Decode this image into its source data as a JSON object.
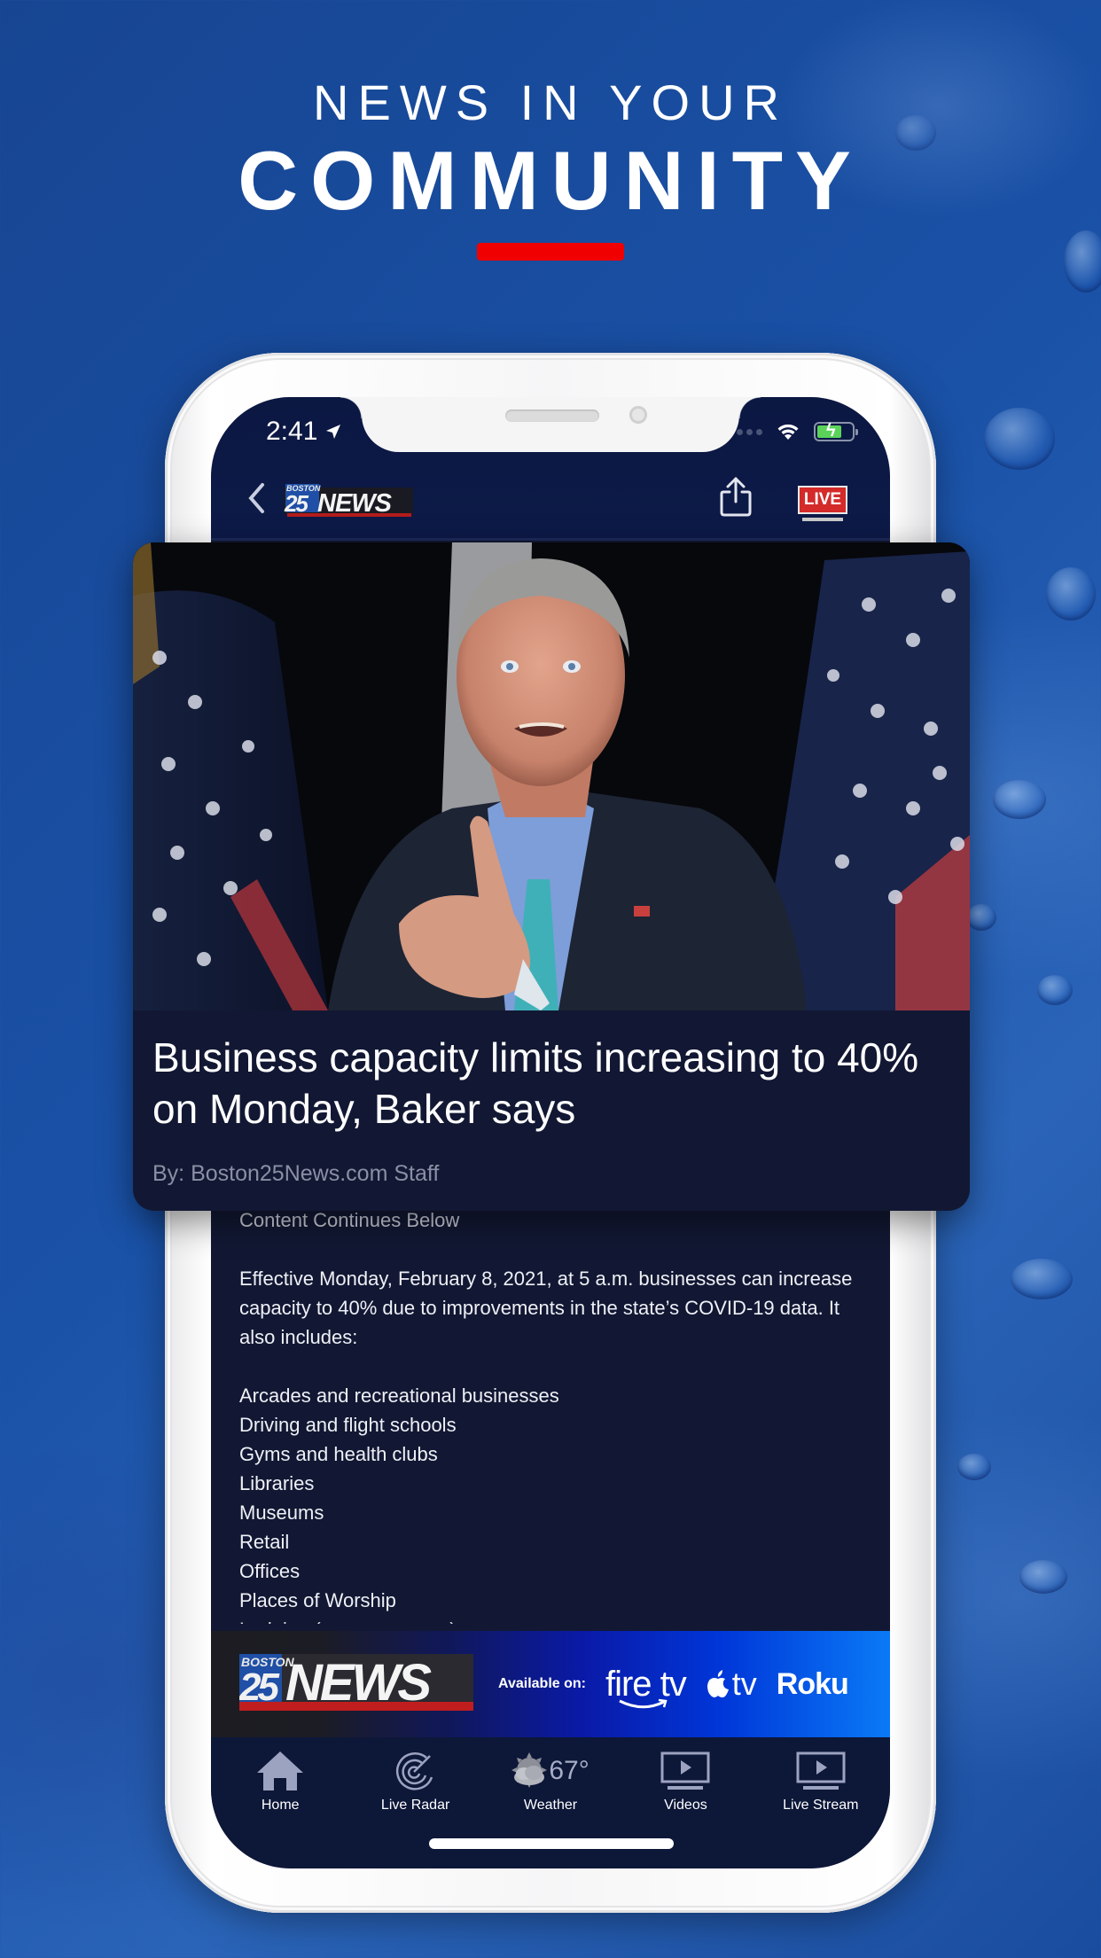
{
  "promo": {
    "line1": "NEWS IN YOUR",
    "line2": "COMMUNITY",
    "accent_color": "#f00000"
  },
  "status_bar": {
    "time": "2:41",
    "location_icon": "location-arrow-icon",
    "wifi_icon": "wifi-icon",
    "battery_icon": "battery-charging-icon"
  },
  "app_bar": {
    "back_icon": "chevron-left-icon",
    "logo": {
      "top": "BOSTON",
      "number": "25",
      "word": "NEWS"
    },
    "share_icon": "share-icon",
    "live_label": "LIVE"
  },
  "article": {
    "image_alt": "Governor speaking at podium in front of American flags",
    "headline": "Business capacity limits increasing to 40% on Monday, Baker says",
    "byline": "By: Boston25News.com Staff",
    "continue_note": "Content Continues Below",
    "paragraph": "Effective Monday, February 8, 2021, at 5 a.m. businesses can increase capacity to 40% due to improvements in the state’s COVID-19 data. It also includes:",
    "list": [
      "Arcades and recreational businesses",
      "Driving and flight schools",
      "Gyms and health clubs",
      "Libraries",
      "Museums",
      "Retail",
      "Offices",
      "Places of Worship",
      "Lodging (common areas)"
    ]
  },
  "banner": {
    "logo": {
      "top": "BOSTON",
      "number": "25",
      "word": "NEWS"
    },
    "available_label": "Available on:",
    "platforms": [
      "fire tv",
      "tv",
      "Roku"
    ]
  },
  "tab_bar": {
    "items": [
      {
        "label": "Home",
        "icon": "home-icon"
      },
      {
        "label": "Live Radar",
        "icon": "radar-icon"
      },
      {
        "label": "Weather",
        "icon": "partly-cloudy-icon",
        "temp": "67°"
      },
      {
        "label": "Videos",
        "icon": "video-play-icon"
      },
      {
        "label": "Live Stream",
        "icon": "live-stream-icon"
      }
    ]
  }
}
